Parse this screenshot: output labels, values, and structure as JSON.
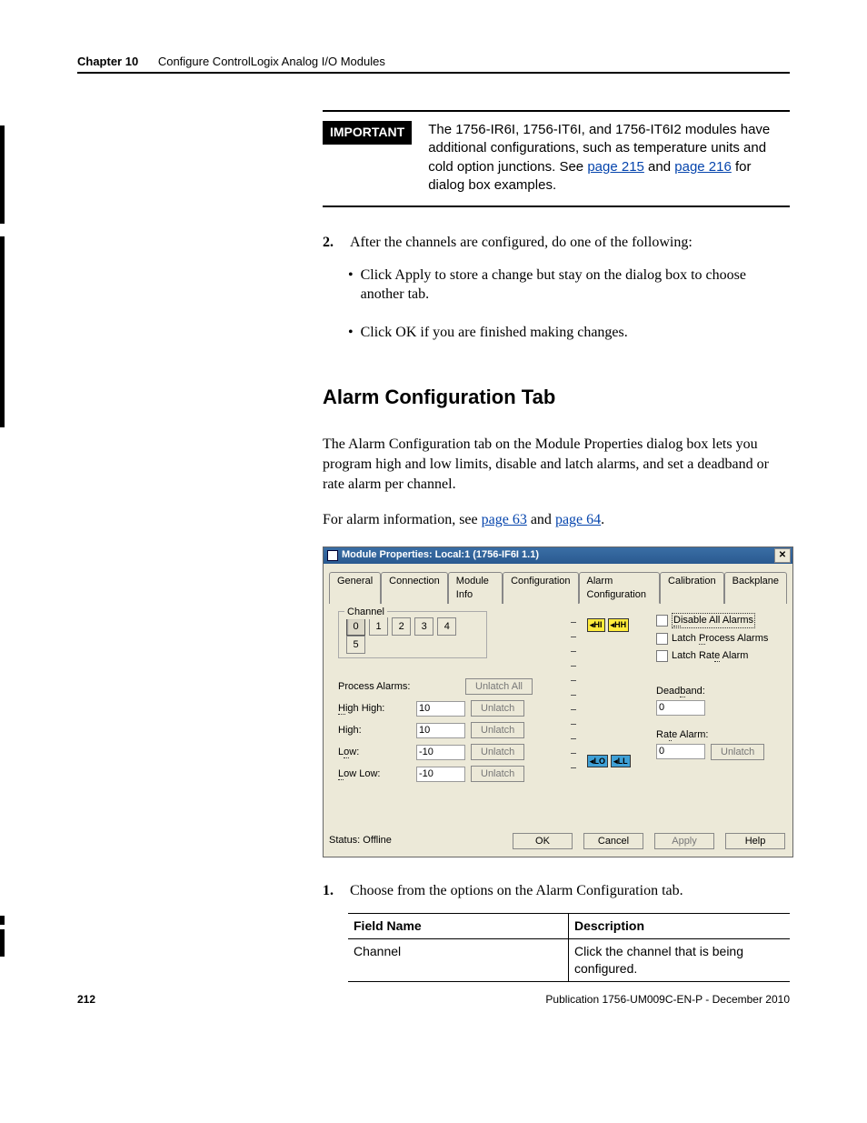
{
  "header": {
    "chapter": "Chapter 10",
    "title": "Configure ControlLogix Analog I/O Modules"
  },
  "important": {
    "tag": "IMPORTANT",
    "text_pre": "The 1756-IR6I, 1756-IT6I, and 1756-IT6I2 modules have additional configurations, such as temperature units and cold option junctions.  See ",
    "link1": "page 215",
    "mid": " and ",
    "link2": "page 216",
    "text_post": " for dialog box examples."
  },
  "step2": {
    "num": "2.",
    "text": "After the channels are configured, do one of the following:",
    "b1": "Click Apply to store a change but stay on the dialog box to choose another tab.",
    "b2": "Click OK if you are finished making changes."
  },
  "section_heading": "Alarm Configuration Tab",
  "para1": "The Alarm Configuration tab on the Module Properties dialog box lets you program high and low limits, disable and latch alarms, and set a deadband or rate alarm per channel.",
  "para2_pre": "For alarm information, see ",
  "para2_link1": "page 63",
  "para2_mid": " and ",
  "para2_link2": "page 64",
  "para2_post": ".",
  "dialog": {
    "title": "Module Properties: Local:1 (1756-IF6I 1.1)",
    "tabs": [
      "General",
      "Connection",
      "Module Info",
      "Configuration",
      "Alarm Configuration",
      "Calibration",
      "Backplane"
    ],
    "active_tab_index": 4,
    "channel_legend": "Channel",
    "channels": [
      "0",
      "1",
      "2",
      "3",
      "4",
      "5"
    ],
    "selected_channel_index": 0,
    "process_alarms_label": "Process Alarms:",
    "unlatch_all": "Unlatch All",
    "rows": [
      {
        "label": "High High:",
        "value": "10",
        "btn": "Unlatch"
      },
      {
        "label": "High:",
        "value": "10",
        "btn": "Unlatch"
      },
      {
        "label": "Low:",
        "value": "-10",
        "btn": "Unlatch"
      },
      {
        "label": "Low Low:",
        "value": "-10",
        "btn": "Unlatch"
      }
    ],
    "badge_hi": "HI",
    "badge_hh": "HH",
    "badge_lo": "LO",
    "badge_ll": "LL",
    "chk_disable": "Disable All Alarms",
    "chk_latch_proc": "Latch Process Alarms",
    "chk_latch_rate": "Latch Rate Alarm",
    "deadband_label": "Deadband:",
    "deadband_value": "0",
    "rate_label": "Rate Alarm:",
    "rate_value": "0",
    "rate_unlatch": "Unlatch",
    "status": "Status: Offline",
    "ok": "OK",
    "cancel": "Cancel",
    "apply": "Apply",
    "help": "Help"
  },
  "step1": {
    "num": "1.",
    "text": "Choose from the options on the Alarm Configuration tab."
  },
  "table": {
    "headers": [
      "Field Name",
      "Description"
    ],
    "rows": [
      [
        "Channel",
        "Click the channel that is being configured."
      ]
    ]
  },
  "footer": {
    "page": "212",
    "pub": "Publication 1756-UM009C-EN-P - December 2010"
  }
}
